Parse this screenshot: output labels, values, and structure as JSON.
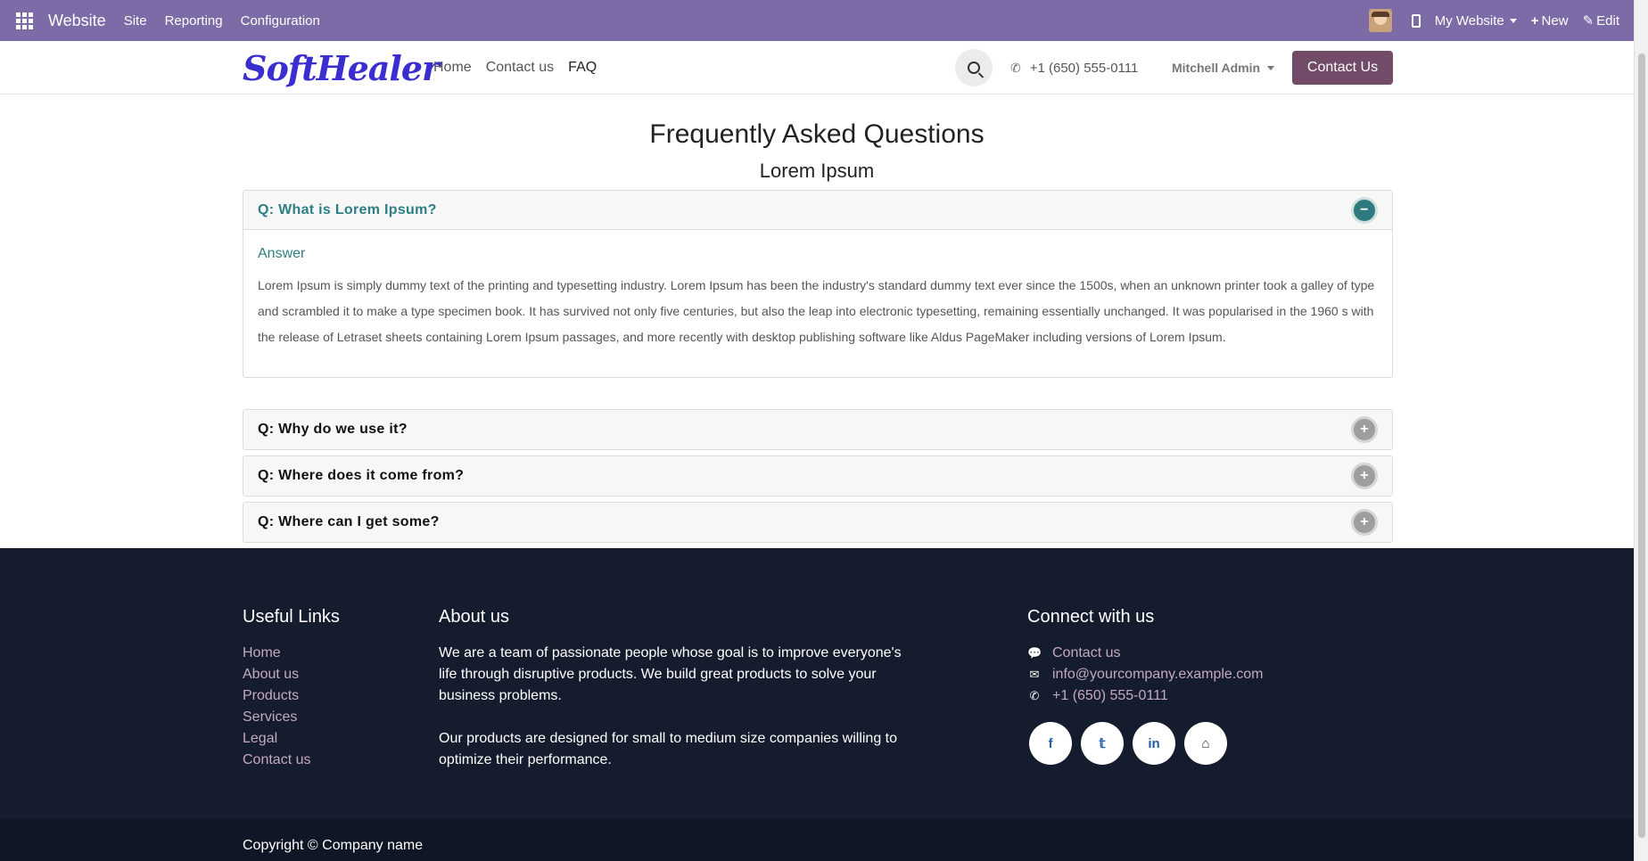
{
  "admin_bar": {
    "brand": "Website",
    "menus": [
      "Site",
      "Reporting",
      "Configuration"
    ],
    "website_switcher": "My Website",
    "new_label": "New",
    "edit_label": "Edit"
  },
  "header": {
    "logo_text": "SoftHealer",
    "nav": [
      "Home",
      "Contact us",
      "FAQ"
    ],
    "active_nav": "FAQ",
    "phone": "+1 (650) 555-0111",
    "user": "Mitchell Admin",
    "contact_button": "Contact Us"
  },
  "main": {
    "title": "Frequently Asked Questions",
    "subtitle": "Lorem Ipsum",
    "faqs": [
      {
        "question": "Q: What is Lorem Ipsum?",
        "expanded": true,
        "answer_label": "Answer",
        "answer": "Lorem Ipsum is simply dummy text of the printing and typesetting industry. Lorem Ipsum has been the industry's standard dummy text ever since the 1500s, when an unknown printer took a galley of type and scrambled it to make a type specimen book. It has survived not only five centuries, but also the leap into electronic typesetting, remaining essentially unchanged. It was popularised in the 1960 s with the release of Letraset sheets containing Lorem Ipsum passages, and more recently with desktop publishing software like Aldus PageMaker including versions of Lorem Ipsum."
      },
      {
        "question": "Q: Why do we use it?",
        "expanded": false
      },
      {
        "question": "Q: Where does it come from?",
        "expanded": false
      },
      {
        "question": "Q: Where can I get some?",
        "expanded": false
      }
    ]
  },
  "footer": {
    "useful_links_title": "Useful Links",
    "useful_links": [
      "Home",
      "About us",
      "Products",
      "Services",
      "Legal",
      "Contact us"
    ],
    "about_title": "About us",
    "about_p1": "We are a team of passionate people whose goal is to improve everyone's life through disruptive products. We build great products to solve your business problems.",
    "about_p2": "Our products are designed for small to medium size companies willing to optimize their performance.",
    "connect_title": "Connect with us",
    "connect_contact": "Contact us",
    "connect_email": "info@yourcompany.example.com",
    "connect_phone": "+1 (650) 555-0111",
    "socials": [
      "facebook-icon",
      "twitter-icon",
      "linkedin-icon",
      "home-icon"
    ],
    "copyright": "Copyright © Company name"
  },
  "colors": {
    "admin_bar": "#7c6ba6",
    "accent": "#714b67",
    "faq_teal": "#2c7f84",
    "footer_bg": "#141c2e"
  }
}
